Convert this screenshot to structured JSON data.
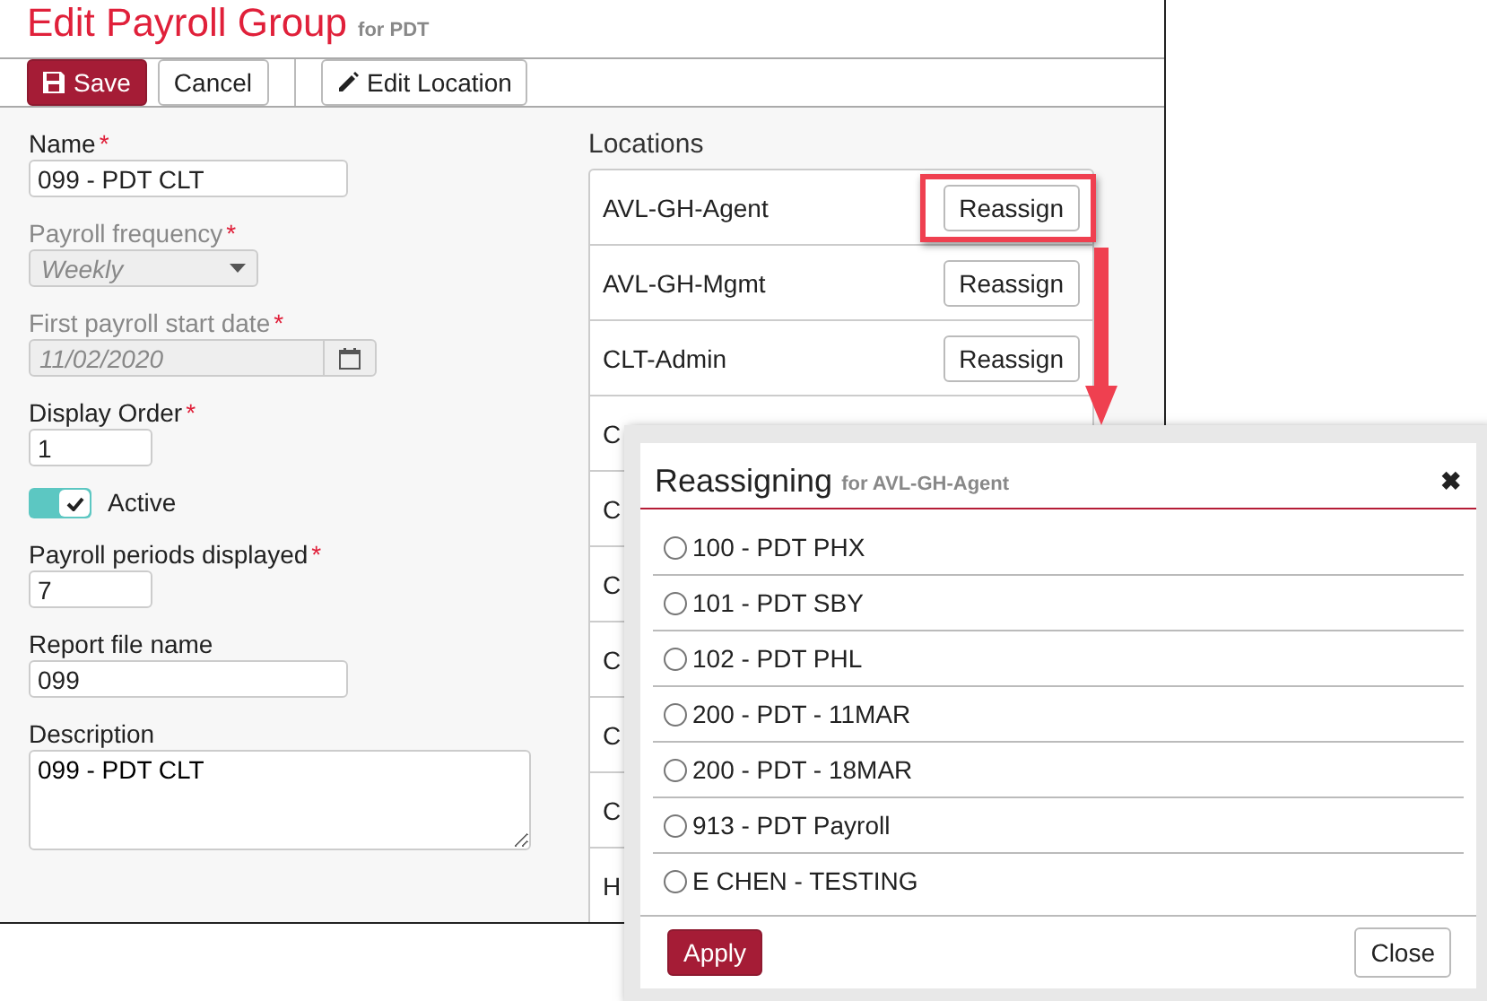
{
  "header": {
    "title": "Edit Payroll Group",
    "subtitle": "for PDT"
  },
  "toolbar": [
    {
      "label": "Save",
      "kind": "primary"
    },
    {
      "label": "Cancel",
      "kind": "plain"
    },
    {
      "label": "Edit Location",
      "kind": "edit"
    }
  ],
  "fields": [
    {
      "kind": "text",
      "label": "Name",
      "required_mark": "*",
      "disabled": false,
      "value": "099 - PDT CLT"
    },
    {
      "kind": "select",
      "label": "Payroll frequency",
      "required_mark": "*",
      "disabled": true,
      "value": "Weekly"
    },
    {
      "kind": "date",
      "label": "First payroll start date",
      "required_mark": "*",
      "disabled": true,
      "value": "11/02/2020"
    },
    {
      "kind": "number",
      "label": "Display Order",
      "required_mark": "*",
      "disabled": false,
      "value": "1"
    },
    {
      "kind": "toggle",
      "label": "Active",
      "on": true
    },
    {
      "kind": "number",
      "label": "Payroll periods displayed",
      "required_mark": "*",
      "disabled": false,
      "value": "7"
    },
    {
      "kind": "text",
      "label": "Report file name",
      "disabled": false,
      "value": "099"
    },
    {
      "kind": "textarea",
      "label": "Description",
      "disabled": false,
      "value": "099 - PDT CLT"
    }
  ],
  "locations": {
    "title": "Locations",
    "items": [
      {
        "name": "AVL-GH-Agent",
        "button": "Reassign",
        "highlighted": true
      },
      {
        "name": "AVL-GH-Mgmt",
        "button": "Reassign",
        "highlighted": false
      },
      {
        "name": "CLT-Admin",
        "button": "Reassign",
        "highlighted": false
      },
      {
        "name": "C",
        "highlighted": false
      },
      {
        "name": "C",
        "highlighted": false
      },
      {
        "name": "C",
        "highlighted": false
      },
      {
        "name": "C",
        "highlighted": false
      },
      {
        "name": "C",
        "highlighted": false
      },
      {
        "name": "C",
        "highlighted": false
      },
      {
        "name": "H",
        "highlighted": false
      }
    ]
  },
  "dialog": {
    "title": "Reassigning",
    "subtitle": "for AVL-GH-Agent",
    "close": "✖",
    "options": [
      {
        "label": "100 - PDT PHX",
        "selected": false
      },
      {
        "label": "101 - PDT SBY",
        "selected": false
      },
      {
        "label": "102 - PDT PHL",
        "selected": false
      },
      {
        "label": "200 - PDT - 11MAR",
        "selected": false
      },
      {
        "label": "200 - PDT - 18MAR",
        "selected": false
      },
      {
        "label": "913 - PDT Payroll",
        "selected": false
      },
      {
        "label": "E CHEN - TESTING",
        "selected": false
      }
    ],
    "apply": "Apply",
    "cancel": "Close"
  }
}
